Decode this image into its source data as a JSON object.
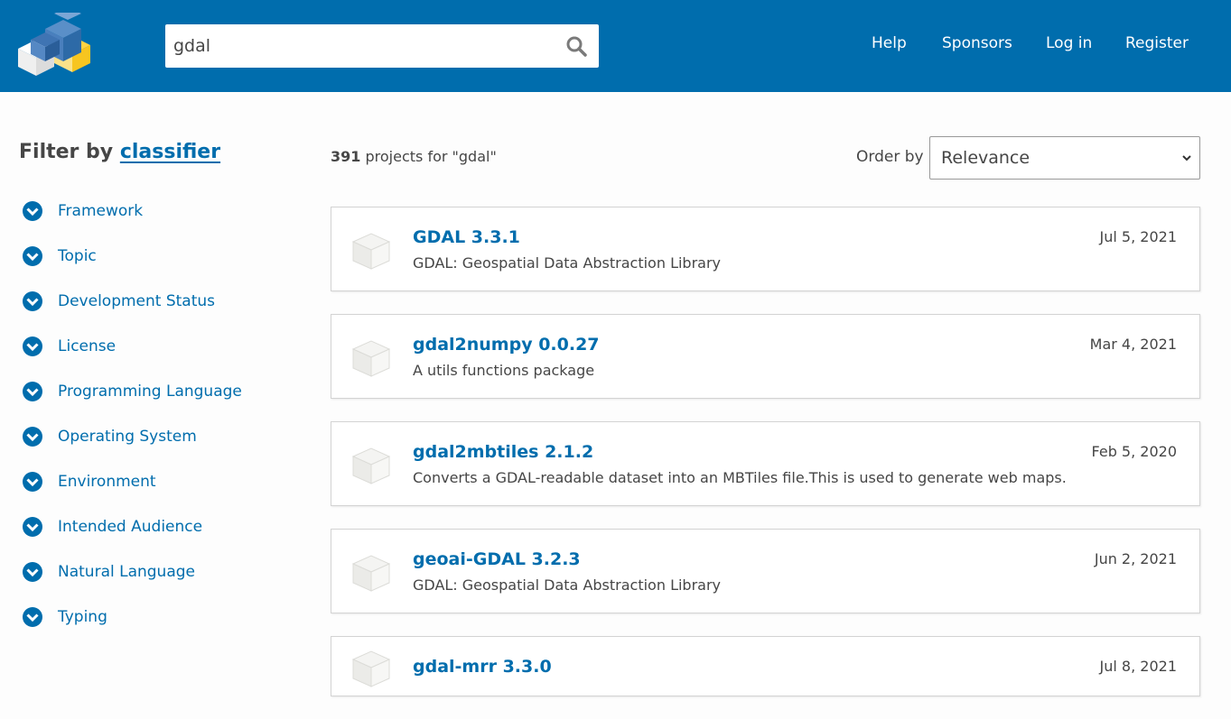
{
  "header": {
    "search": {
      "value": "gdal",
      "icon": "search-icon"
    },
    "nav": [
      "Help",
      "Sponsors",
      "Log in",
      "Register"
    ],
    "colors": {
      "bar": "#006dad",
      "text": "#ffffff"
    }
  },
  "sidebar": {
    "title_prefix": "Filter by",
    "title_link": "classifier",
    "items": [
      {
        "label": "Framework"
      },
      {
        "label": "Topic"
      },
      {
        "label": "Development Status"
      },
      {
        "label": "License"
      },
      {
        "label": "Programming Language"
      },
      {
        "label": "Operating System"
      },
      {
        "label": "Environment"
      },
      {
        "label": "Intended Audience"
      },
      {
        "label": "Natural Language"
      },
      {
        "label": "Typing"
      }
    ]
  },
  "results_header": {
    "count": "391",
    "count_text": "projects for \"gdal\"",
    "order_label": "Order by",
    "order_value": "Relevance"
  },
  "results": [
    {
      "name": "GDAL 3.3.1",
      "description": "GDAL: Geospatial Data Abstraction Library",
      "date": "Jul 5, 2021"
    },
    {
      "name": "gdal2numpy 0.0.27",
      "description": "A utils functions package",
      "date": "Mar 4, 2021"
    },
    {
      "name": "gdal2mbtiles 2.1.2",
      "description": "Converts a GDAL-readable dataset into an MBTiles file.This is used to generate web maps.",
      "date": "Feb 5, 2020"
    },
    {
      "name": "geoai-GDAL 3.2.3",
      "description": "GDAL: Geospatial Data Abstraction Library",
      "date": "Jun 2, 2021"
    },
    {
      "name": "gdal-mrr 3.3.0",
      "description": "",
      "date": "Jul 8, 2021"
    }
  ]
}
